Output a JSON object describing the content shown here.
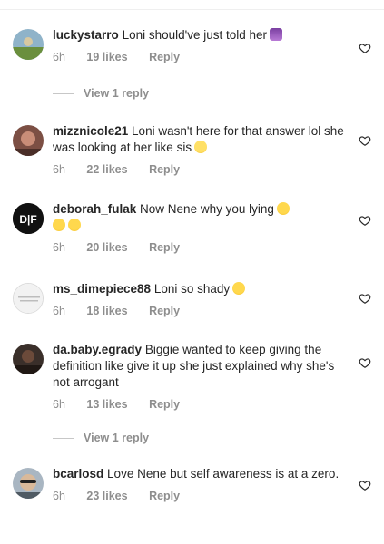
{
  "comments": [
    {
      "username": "luckystarro",
      "text": "Loni should've just told her",
      "emoji": "person-shrugging",
      "time": "6h",
      "likes": "19 likes",
      "reply": "Reply",
      "avatar_color": "#6a8f3d"
    },
    {
      "username": "mizznicole21",
      "text": "Loni wasn't here for that answer lol she was looking at her like sis",
      "emoji": "grimacing-face",
      "time": "6h",
      "likes": "22 likes",
      "reply": "Reply",
      "avatar_color": "#b4736a"
    },
    {
      "username": "deborah_fulak",
      "text": "Now Nene why you lying",
      "emoji": "laughing-face",
      "time": "6h",
      "likes": "20 likes",
      "reply": "Reply",
      "avatar_text": "D|F",
      "avatar_color": "#111111"
    },
    {
      "username": "ms_dimepiece88",
      "text": "Loni so shady",
      "emoji": "laughing-face",
      "time": "6h",
      "likes": "18 likes",
      "reply": "Reply",
      "avatar_color": "#e8e8e8"
    },
    {
      "username": "da.baby.egrady",
      "text": "Biggie wanted to keep giving the definition like give it up she just explained why she's not arrogant",
      "time": "6h",
      "likes": "13 likes",
      "reply": "Reply",
      "avatar_color": "#3a2f2a"
    },
    {
      "username": "bcarlosd",
      "text": "Love Nene but self awareness is at a zero.",
      "time": "6h",
      "likes": "23 likes",
      "reply": "Reply",
      "avatar_color": "#6f7d8a"
    }
  ],
  "view_replies": [
    {
      "label": "View 1 reply"
    },
    {
      "label": "View 1 reply"
    }
  ],
  "colors": {
    "text": "#262626",
    "secondary": "#8e8e8e",
    "divider": "#efefef"
  }
}
